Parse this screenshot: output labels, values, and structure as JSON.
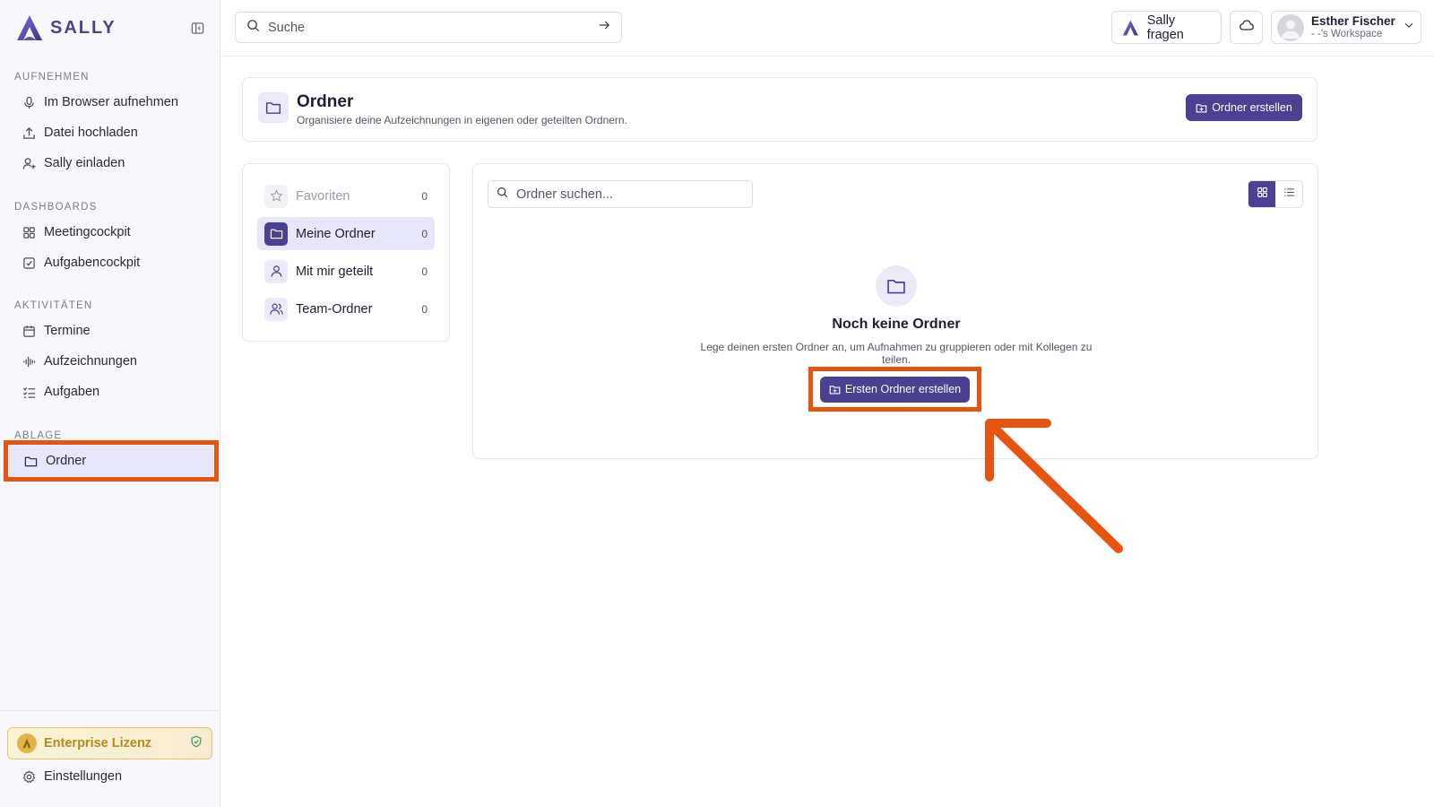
{
  "app": {
    "brand": "SALLY",
    "brand_color": "#4a4193",
    "highlight_color": "#e65410"
  },
  "sidebar": {
    "sections": [
      {
        "title": "AUFNEHMEN",
        "items": [
          {
            "label": "Im Browser aufnehmen",
            "icon": "microphone-icon"
          },
          {
            "label": "Datei hochladen",
            "icon": "upload-icon"
          },
          {
            "label": "Sally einladen",
            "icon": "user-plus-icon"
          }
        ]
      },
      {
        "title": "DASHBOARDS",
        "items": [
          {
            "label": "Meetingcockpit",
            "icon": "grid-icon"
          },
          {
            "label": "Aufgabencockpit",
            "icon": "checkbox-icon"
          }
        ]
      },
      {
        "title": "AKTIVITÄTEN",
        "items": [
          {
            "label": "Termine",
            "icon": "calendar-icon"
          },
          {
            "label": "Aufzeichnungen",
            "icon": "waveform-icon"
          },
          {
            "label": "Aufgaben",
            "icon": "task-list-icon"
          }
        ]
      },
      {
        "title": "ABLAGE",
        "items": [
          {
            "label": "Ordner",
            "icon": "folder-icon",
            "active": true
          }
        ]
      }
    ],
    "license_label": "Enterprise Lizenz",
    "settings_label": "Einstellungen"
  },
  "topbar": {
    "search_placeholder": "Suche",
    "ask_label": "Sally fragen",
    "user_name": "Esther Fischer",
    "workspace": "- -'s Workspace"
  },
  "header": {
    "title": "Ordner",
    "subtitle": "Organisiere deine Aufzeichnungen in eigenen oder geteilten Ordnern.",
    "create_label": "Ordner erstellen"
  },
  "categories": [
    {
      "label": "Favoriten",
      "count": "0",
      "icon": "star-icon",
      "disabled": true
    },
    {
      "label": "Meine Ordner",
      "count": "0",
      "icon": "folder-icon",
      "active": true
    },
    {
      "label": "Mit mir geteilt",
      "count": "0",
      "icon": "user-icon"
    },
    {
      "label": "Team-Ordner",
      "count": "0",
      "icon": "users-icon"
    }
  ],
  "content": {
    "search_placeholder": "Ordner suchen...",
    "view_mode": "grid",
    "empty_title": "Noch keine Ordner",
    "empty_desc": "Lege deinen ersten Ordner an, um Aufnahmen zu gruppieren oder mit Kollegen zu teilen.",
    "first_button_label": "Ersten Ordner erstellen"
  }
}
